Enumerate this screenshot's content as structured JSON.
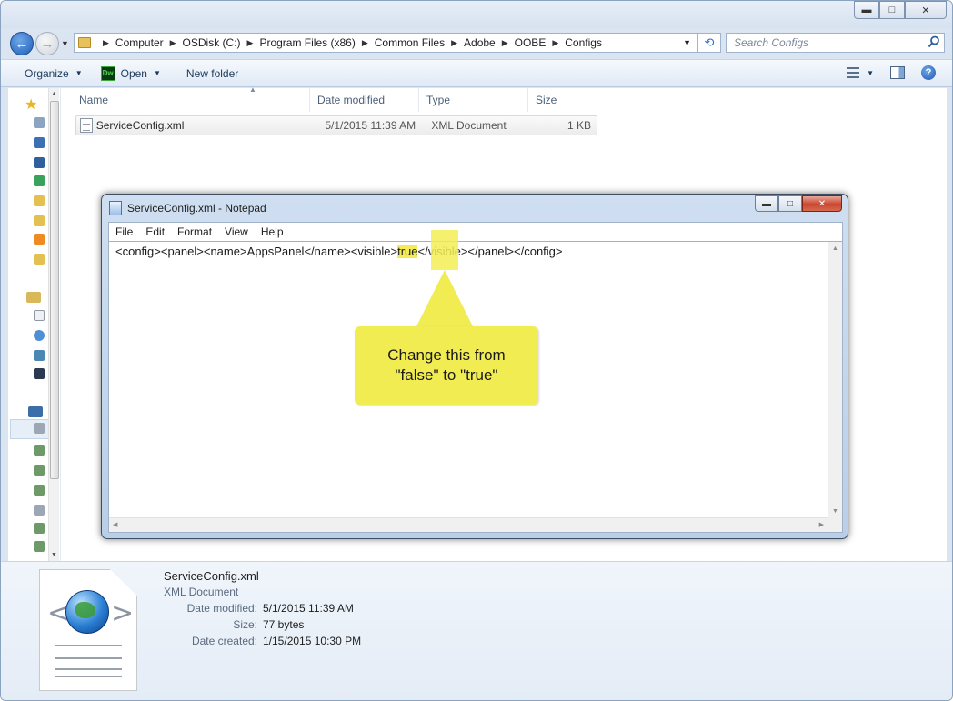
{
  "explorer": {
    "window_buttons": {
      "minimize": "▬",
      "maximize": "□",
      "close": "✕"
    },
    "address": {
      "crumbs": [
        "Computer",
        "OSDisk (C:)",
        "Program Files (x86)",
        "Common Files",
        "Adobe",
        "OOBE",
        "Configs"
      ]
    },
    "search": {
      "placeholder": "Search Configs"
    },
    "toolbar": {
      "organize": "Organize",
      "open": "Open",
      "new_folder": "New folder"
    },
    "columns": {
      "name": "Name",
      "date": "Date modified",
      "type": "Type",
      "size": "Size"
    },
    "files": [
      {
        "name": "ServiceConfig.xml",
        "date": "5/1/2015 11:39 AM",
        "type": "XML Document",
        "size": "1 KB"
      }
    ],
    "details": {
      "name": "ServiceConfig.xml",
      "type": "XML Document",
      "date_modified_label": "Date modified:",
      "date_modified": "5/1/2015 11:39 AM",
      "size_label": "Size:",
      "size": "77 bytes",
      "date_created_label": "Date created:",
      "date_created": "1/15/2015 10:30 PM"
    }
  },
  "notepad": {
    "title": "ServiceConfig.xml - Notepad",
    "menus": [
      "File",
      "Edit",
      "Format",
      "View",
      "Help"
    ],
    "text_before": "<config><panel><name>AppsPanel</name><visible>",
    "text_highlight": "true",
    "text_after": "</visible></panel></config>"
  },
  "callout": {
    "line1": "Change this from",
    "line2": "\"false\" to \"true\""
  },
  "colors": {
    "highlight": "#f1ec52",
    "accent": "#1f5fb8"
  }
}
